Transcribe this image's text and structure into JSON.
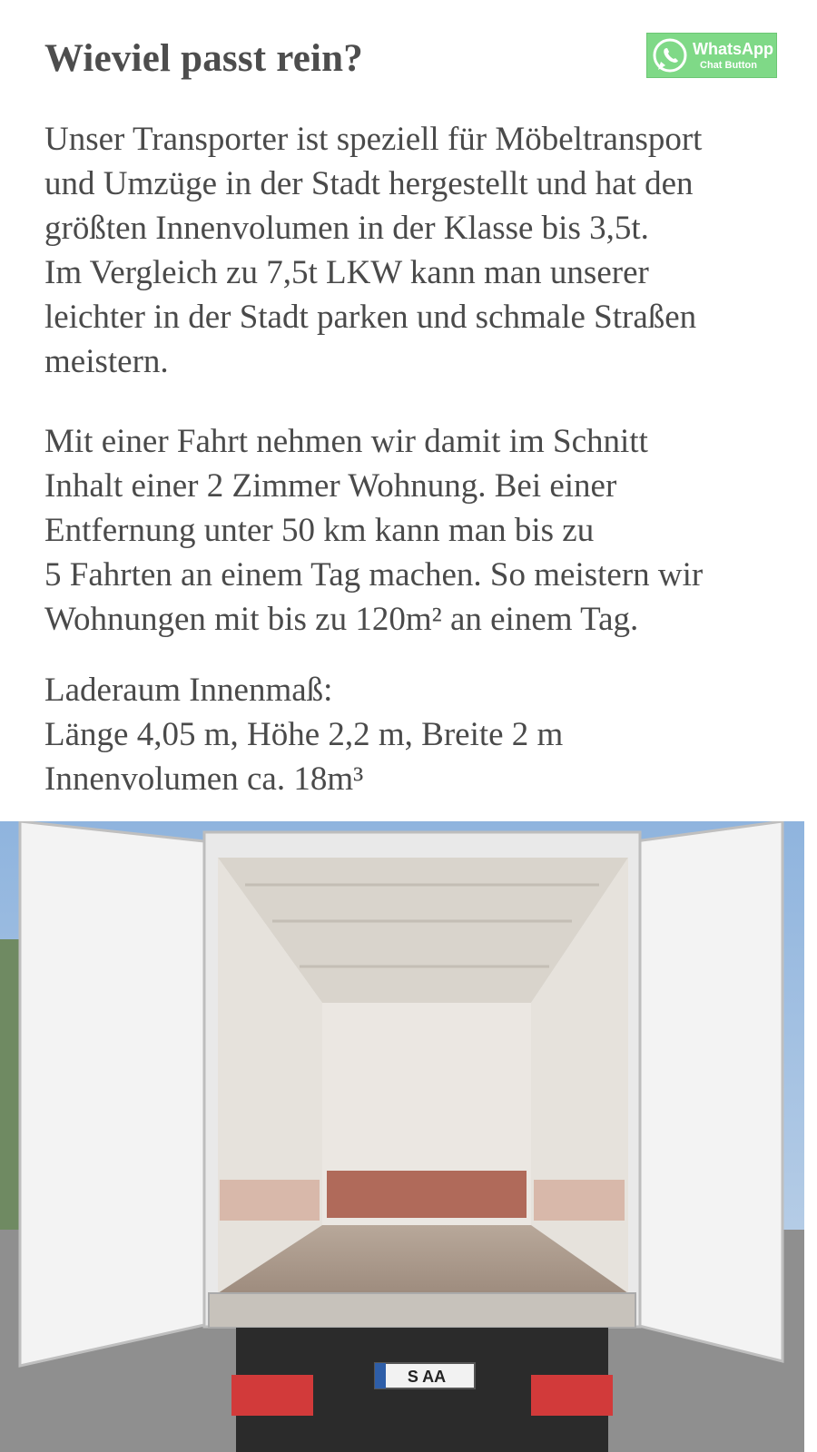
{
  "heading": "Wieviel passt rein?",
  "whatsapp": {
    "label": "WhatsApp",
    "sublabel": "Chat Button"
  },
  "paragraph1": [
    "Unser Transporter ist speziell für Möbeltransport",
    "und Umzüge in der Stadt hergestellt und hat den",
    "größten Innenvolumen in der Klasse bis 3,5t.",
    "Im Vergleich zu 7,5t LKW kann man unserer",
    "leichter in der Stadt parken und schmale Straßen",
    "meistern."
  ],
  "paragraph2": [
    "Mit einer Fahrt nehmen wir damit im Schnitt",
    "Inhalt einer 2 Zimmer Wohnung. Bei einer",
    "Entfernung unter 50 km kann man bis zu",
    "5 Fahrten an einem Tag machen. So meistern wir",
    "Wohnungen mit bis zu 120m² an einem Tag."
  ],
  "specs": [
    "Laderaum Innenmaß:",
    "Länge 4,05 m, Höhe 2,2 m, Breite 2 m",
    "Innenvolumen ca. 18m³"
  ],
  "photo": {
    "license_plate": "S AA"
  },
  "colors": {
    "whatsapp_green": "#7fd987",
    "text": "#4a4a4a"
  }
}
